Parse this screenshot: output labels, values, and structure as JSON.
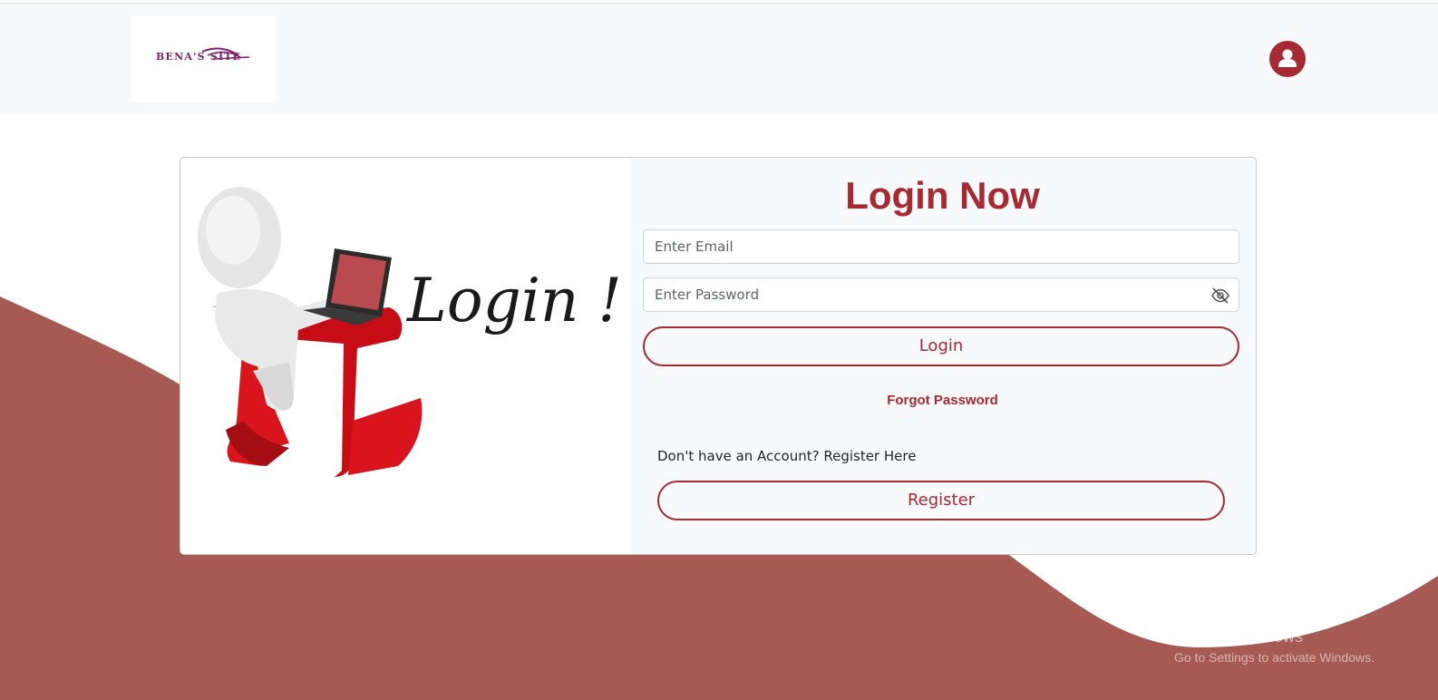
{
  "colors": {
    "accent": "#a52a33",
    "wave": "#a65a53",
    "navbar_bg": "#f8f9fa",
    "form_bg": "#f8f9fa"
  },
  "header": {
    "logo_text": "BENA'S SITE",
    "user_icon": "user-icon"
  },
  "illustration": {
    "caption": "Login !"
  },
  "form": {
    "title": "Login Now",
    "email_placeholder": "Enter Email",
    "password_placeholder": "Enter Password",
    "password_toggle_icon": "eye-slash-icon",
    "login_label": "Login",
    "forgot_label": "Forgot Password",
    "register_prompt": "Don't have an Account? Register Here",
    "register_label": "Register"
  },
  "watermark": {
    "title": "Activate Windows",
    "subtitle": "Go to Settings to activate Windows."
  }
}
